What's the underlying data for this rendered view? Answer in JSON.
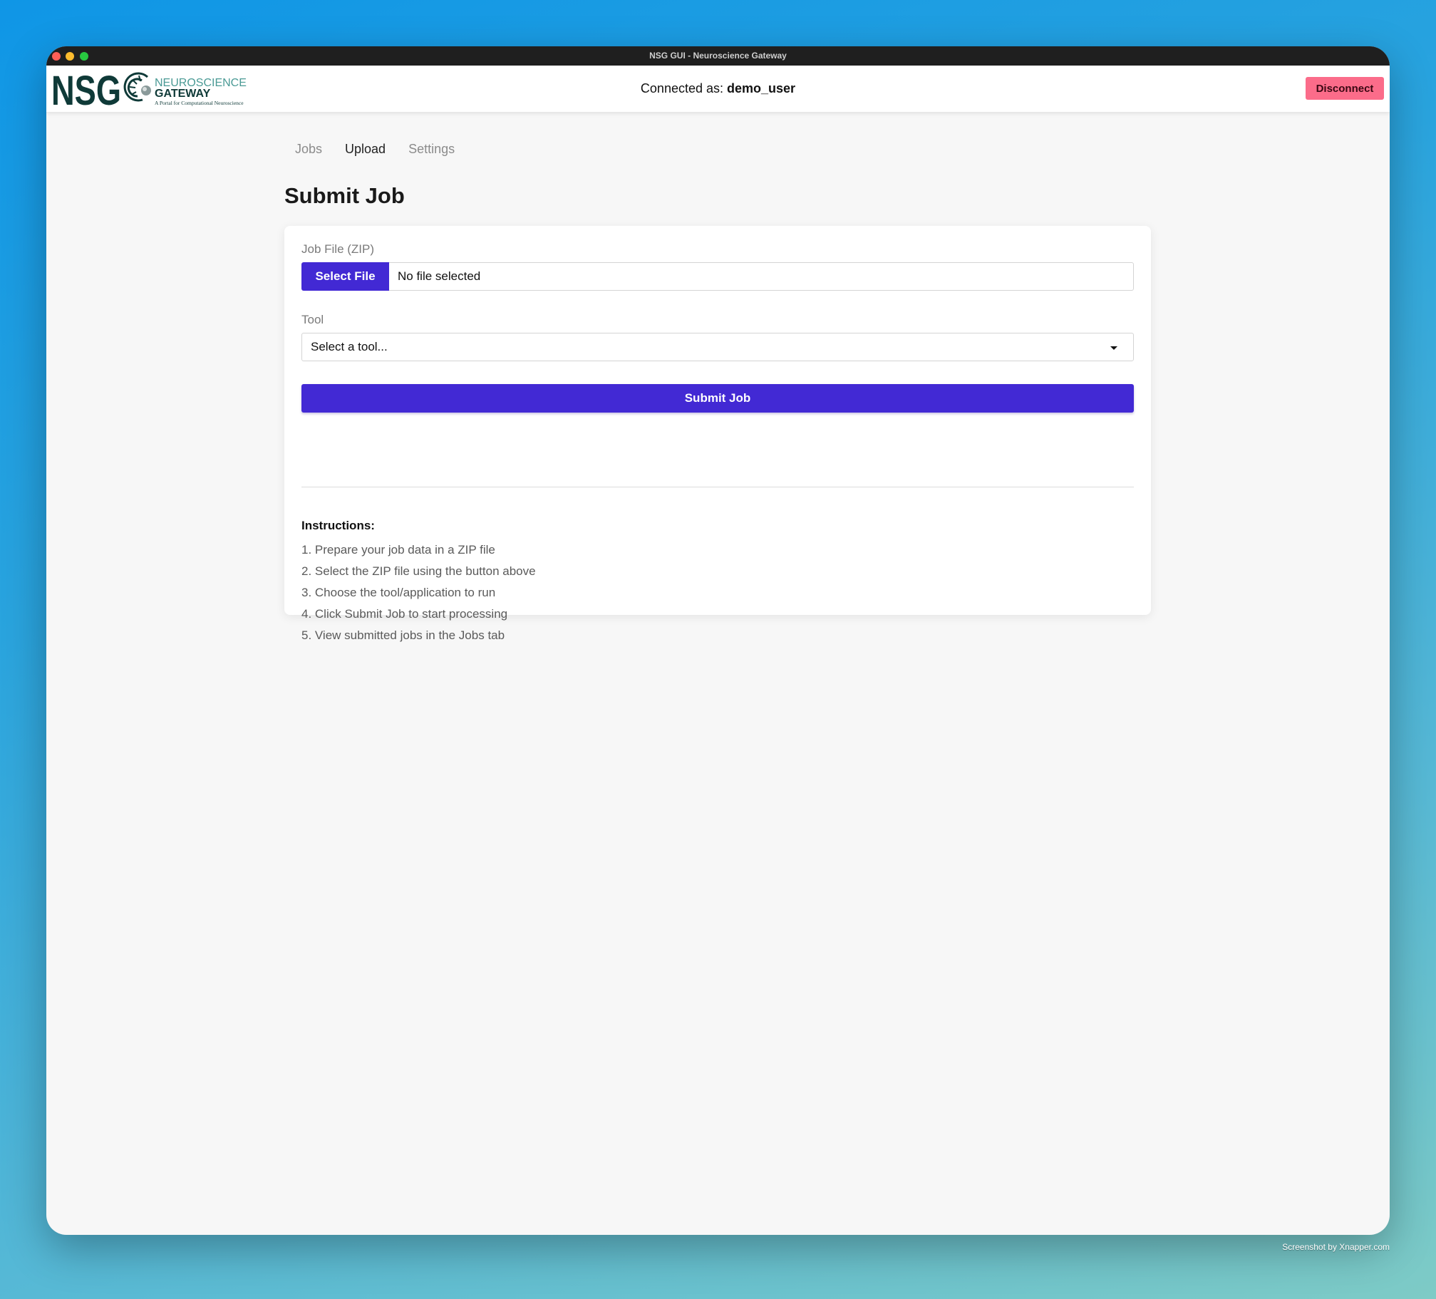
{
  "window": {
    "title": "NSG GUI - Neuroscience Gateway"
  },
  "header": {
    "logo_text_main": "NSG",
    "logo_text_line1": "NEUROSCIENCE",
    "logo_text_line2": "GATEWAY",
    "logo_text_tagline": "A Portal for Computational Neuroscience",
    "connected_label": "Connected as:",
    "username": "demo_user",
    "disconnect_label": "Disconnect"
  },
  "tabs": [
    {
      "label": "Jobs",
      "active": false
    },
    {
      "label": "Upload",
      "active": true
    },
    {
      "label": "Settings",
      "active": false
    }
  ],
  "page": {
    "title": "Submit Job"
  },
  "form": {
    "file_label": "Job File (ZIP)",
    "select_file_label": "Select File",
    "file_status": "No file selected",
    "tool_label": "Tool",
    "tool_selected": "Select a tool...",
    "submit_label": "Submit Job"
  },
  "instructions": {
    "title": "Instructions:",
    "steps": [
      "1. Prepare your job data in a ZIP file",
      "2. Select the ZIP file using the button above",
      "3. Choose the tool/application to run",
      "4. Click Submit Job to start processing",
      "5. View submitted jobs in the Jobs tab"
    ]
  },
  "footer": {
    "watermark": "Screenshot by Xnapper.com"
  },
  "colors": {
    "primary": "#4229d4",
    "danger": "#fb6c8a",
    "logo_dark": "#0f3a38",
    "logo_teal": "#4a9a95"
  },
  "icons": {
    "dropdown": "chevron-down-icon",
    "logo": "nsg-logo"
  }
}
